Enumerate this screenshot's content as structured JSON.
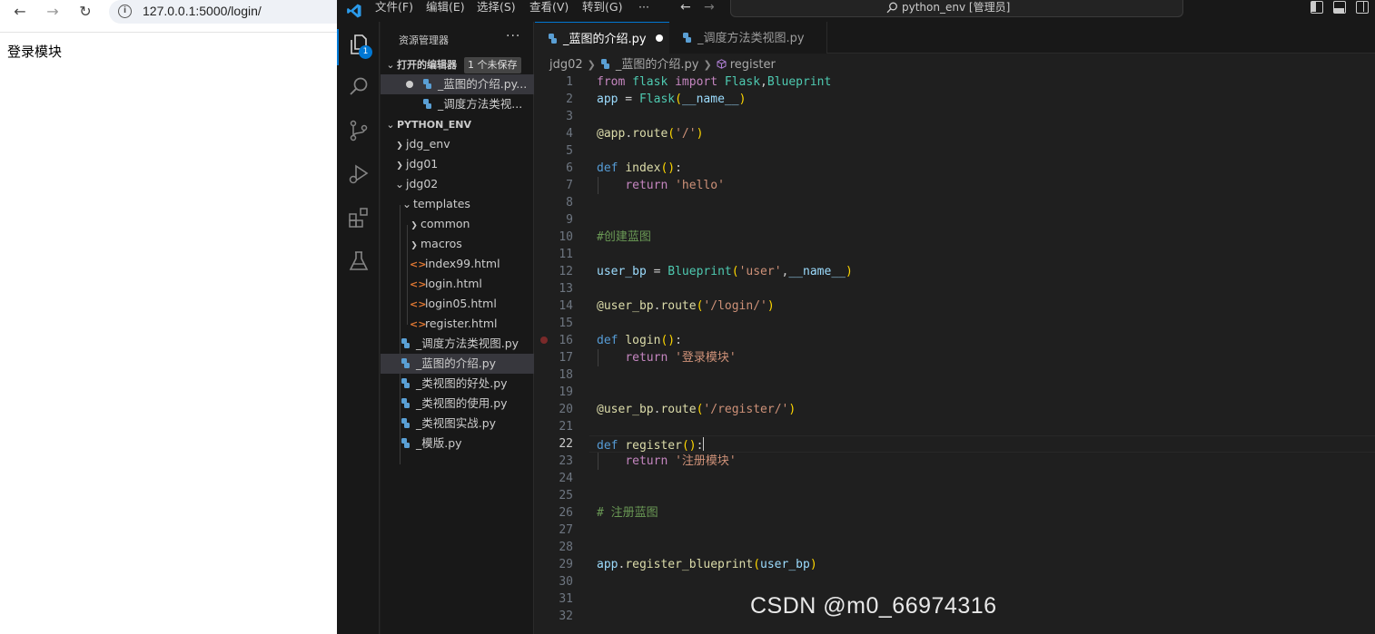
{
  "browser": {
    "url": "127.0.0.1:5000/login/",
    "page_text": "登录模块"
  },
  "titlebar": {
    "menus": [
      "文件(F)",
      "编辑(E)",
      "选择(S)",
      "查看(V)",
      "转到(G)",
      "···"
    ],
    "command_center": "python_env [管理员]"
  },
  "activity": {
    "explorer_badge": "1"
  },
  "sidebar": {
    "title": "资源管理器",
    "more": "···",
    "open_editors": {
      "label": "打开的编辑器",
      "badge": "1 个未保存",
      "items": [
        "_蓝图的介绍.py...",
        "_调度方法类视..."
      ]
    },
    "workspace": {
      "label": "PYTHON_ENV",
      "items": [
        {
          "label": "jdg_env",
          "type": "folder",
          "state": "collapsed"
        },
        {
          "label": "jdg01",
          "type": "folder",
          "state": "collapsed"
        },
        {
          "label": "jdg02",
          "type": "folder",
          "state": "expanded"
        },
        {
          "label": "templates",
          "type": "folder",
          "state": "expanded"
        },
        {
          "label": "common",
          "type": "folder",
          "state": "collapsed"
        },
        {
          "label": "macros",
          "type": "folder",
          "state": "collapsed"
        },
        {
          "label": "index99.html",
          "type": "html"
        },
        {
          "label": "login.html",
          "type": "html"
        },
        {
          "label": "login05.html",
          "type": "html"
        },
        {
          "label": "register.html",
          "type": "html"
        },
        {
          "label": "_调度方法类视图.py",
          "type": "py"
        },
        {
          "label": "_蓝图的介绍.py",
          "type": "py",
          "selected": true
        },
        {
          "label": "_类视图的好处.py",
          "type": "py"
        },
        {
          "label": "_类视图的使用.py",
          "type": "py"
        },
        {
          "label": "_类视图实战.py",
          "type": "py"
        },
        {
          "label": "_模版.py",
          "type": "py"
        }
      ]
    }
  },
  "editor": {
    "tabs": [
      {
        "label": "_蓝图的介绍.py",
        "active": true,
        "dirty": true
      },
      {
        "label": "_调度方法类视图.py",
        "active": false
      }
    ],
    "breadcrumb": [
      "jdg02",
      "_蓝图的介绍.py",
      "register"
    ],
    "current_line": 22,
    "code_lines": [
      "from flask import Flask,Blueprint",
      "app = Flask(__name__)",
      "",
      "@app.route('/')",
      "",
      "def index():",
      "    return 'hello'",
      "",
      "",
      "#创建蓝图",
      "",
      "user_bp = Blueprint('user',__name__)",
      "",
      "@user_bp.route('/login/')",
      "",
      "def login():",
      "    return '登录模块'",
      "",
      "",
      "@user_bp.route('/register/')",
      "",
      "def register():",
      "    return '注册模块'",
      "",
      "",
      "# 注册蓝图",
      "",
      "",
      "app.register_blueprint(user_bp)",
      "",
      "",
      ""
    ]
  },
  "watermark": "CSDN @m0_66974316",
  "colors": {
    "accent": "#0078d4",
    "keyword": "#569cd6",
    "string": "#ce9178",
    "function": "#dcdcaa",
    "class": "#4ec9b0",
    "comment": "#6a9955"
  }
}
